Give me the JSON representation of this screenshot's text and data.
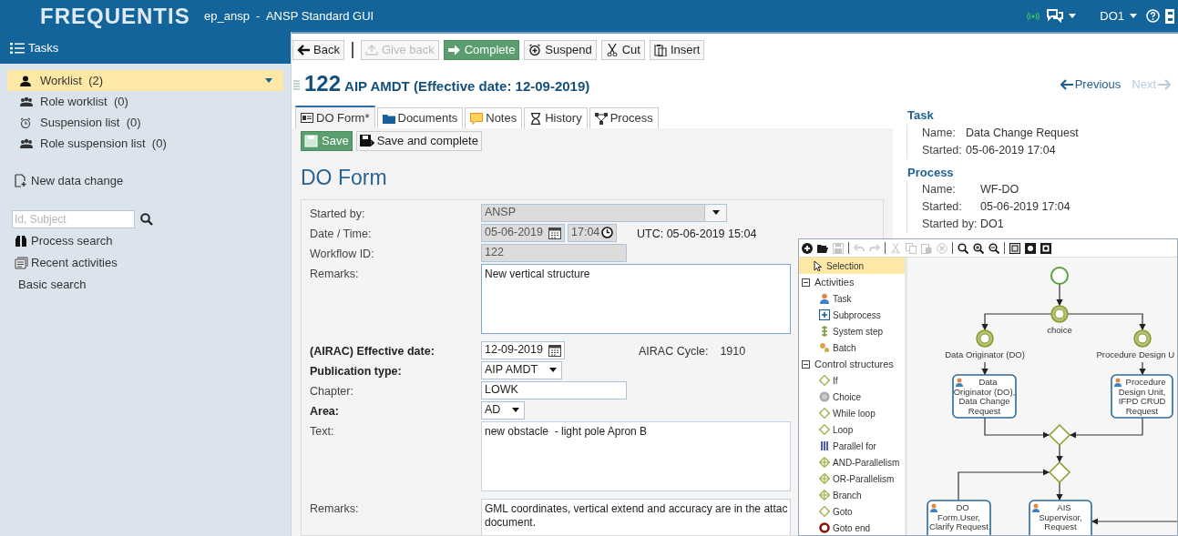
{
  "header": {
    "logo": "FREQUENTIS",
    "title": "ep_ansp  -  ANSP Standard GUI",
    "user": "DO1"
  },
  "sidebar": {
    "title": "Tasks",
    "lists": [
      {
        "kind": "person",
        "label": "Worklist",
        "count": "(2)",
        "selected": true
      },
      {
        "kind": "group",
        "label": "Role worklist",
        "count": "(0)",
        "selected": false
      },
      {
        "kind": "alarm",
        "label": "Suspension list",
        "count": "(0)",
        "selected": false
      },
      {
        "kind": "group",
        "label": "Role suspension list",
        "count": "(0)",
        "selected": false
      }
    ],
    "new_data_change": "New data change",
    "search": {
      "placeholder": "Id, Subject"
    },
    "links": [
      {
        "kind": "binoculars",
        "label": "Process search"
      },
      {
        "kind": "papers",
        "label": "Recent activities"
      },
      {
        "kind": "none",
        "label": "Basic search"
      }
    ]
  },
  "toolbar": [
    {
      "kind": "back",
      "label": "Back",
      "disabled": false
    },
    {
      "kind": "give_back",
      "label": "Give back",
      "disabled": true
    },
    {
      "kind": "complete",
      "label": "Complete",
      "disabled": false
    },
    {
      "kind": "suspend",
      "label": "Suspend",
      "disabled": false
    },
    {
      "kind": "cut",
      "label": "Cut",
      "disabled": false
    },
    {
      "kind": "insert",
      "label": "Insert",
      "disabled": false
    }
  ],
  "task": {
    "number": "122",
    "title": "AIP AMDT (Effective date: 12-09-2019)",
    "previous": {
      "label": "Previous",
      "disabled": false
    },
    "next": {
      "label": "Next",
      "disabled": true
    }
  },
  "tabs": [
    {
      "kind": "form",
      "label": "DO Form*",
      "selected": true
    },
    {
      "kind": "documents",
      "label": "Documents",
      "selected": false
    },
    {
      "kind": "notes",
      "label": "Notes",
      "selected": false
    },
    {
      "kind": "history",
      "label": "History",
      "selected": false
    },
    {
      "kind": "process",
      "label": "Process",
      "selected": false
    }
  ],
  "form_buttons": [
    {
      "kind": "save",
      "label": "Save"
    },
    {
      "kind": "save_complete",
      "label": "Save and complete"
    }
  ],
  "form": {
    "title": "DO Form",
    "fields": [
      {
        "kind": "select",
        "label": "Started by:",
        "bold": false,
        "value": "ANSP",
        "disabled": true
      },
      {
        "kind": "datetime",
        "label": "Date / Time:",
        "bold": false,
        "date": "05-06-2019",
        "time": "17:04",
        "disabled": true,
        "info": "UTC: 05-06-2019 15:04"
      },
      {
        "kind": "text",
        "label": "Workflow ID:",
        "bold": false,
        "value": "122",
        "disabled": true
      },
      {
        "kind": "textarea",
        "label": "Remarks:",
        "bold": false,
        "value": "New vertical structure",
        "focused": true
      },
      {
        "kind": "date",
        "label": "(AIRAC) Effective date:",
        "bold": true,
        "date": "12-09-2019",
        "info_label": "AIRAC Cycle:",
        "info_value": "1910"
      },
      {
        "kind": "select",
        "label": "Publication type:",
        "bold": true,
        "value": "AIP AMDT",
        "disabled": false
      },
      {
        "kind": "spacer"
      },
      {
        "kind": "text",
        "label": "Chapter:",
        "bold": false,
        "value": "LOWK",
        "disabled": false
      },
      {
        "kind": "select",
        "label": "Area:",
        "bold": true,
        "value": "AD",
        "disabled": false
      },
      {
        "kind": "textarea",
        "label": "Text:",
        "bold": false,
        "value": "new obstacle  - light pole Apron B",
        "focused": false
      },
      {
        "kind": "textarea",
        "label": "Remarks:",
        "bold": false,
        "value": "GML coordinates, vertical extend and accuracy are in the attac\ndocument.",
        "focused": false
      }
    ]
  },
  "info": [
    {
      "title": "Task",
      "rows": [
        {
          "label": "Name:",
          "value": "Data Change Request"
        },
        {
          "label": "Started:",
          "value": "05-06-2019 17:04"
        }
      ]
    },
    {
      "title": "Process",
      "rows": [
        {
          "label": "Name:",
          "value": "WF-DO"
        },
        {
          "label": "Started:",
          "value": "05-06-2019 17:04"
        },
        {
          "label": "Started by:",
          "value": "DO1"
        }
      ]
    }
  ],
  "editor": {
    "toolbar": [
      {
        "kind": "add",
        "disabled": false
      },
      {
        "kind": "open",
        "disabled": false
      },
      {
        "kind": "save",
        "disabled": true
      },
      {
        "kind": "sep"
      },
      {
        "kind": "undo",
        "disabled": true
      },
      {
        "kind": "redo",
        "disabled": true
      },
      {
        "kind": "sep"
      },
      {
        "kind": "cut",
        "disabled": true
      },
      {
        "kind": "copy",
        "disabled": true
      },
      {
        "kind": "paste",
        "disabled": true
      },
      {
        "kind": "delete",
        "disabled": true
      },
      {
        "kind": "sep"
      },
      {
        "kind": "zoom",
        "disabled": false
      },
      {
        "kind": "zoom_in",
        "disabled": false
      },
      {
        "kind": "zoom_out",
        "disabled": false
      },
      {
        "kind": "sep"
      },
      {
        "kind": "fit",
        "disabled": false
      },
      {
        "kind": "view",
        "disabled": false
      },
      {
        "kind": "view2",
        "disabled": false
      }
    ],
    "palette": [
      {
        "kind": "selection",
        "label": "Selection",
        "selected": true
      },
      {
        "kind": "group",
        "label": "Activities",
        "expanded": true,
        "children": [
          {
            "kind": "task",
            "label": "Task"
          },
          {
            "kind": "subprocess",
            "label": "Subprocess"
          },
          {
            "kind": "system",
            "label": "System step"
          },
          {
            "kind": "batch",
            "label": "Batch"
          }
        ]
      },
      {
        "kind": "group",
        "label": "Control structures",
        "expanded": true,
        "children": [
          {
            "kind": "if",
            "label": "If"
          },
          {
            "kind": "choice",
            "label": "Choice"
          },
          {
            "kind": "while",
            "label": "While loop"
          },
          {
            "kind": "loop",
            "label": "Loop"
          },
          {
            "kind": "parallel",
            "label": "Parallel for"
          },
          {
            "kind": "and",
            "label": "AND-Parallelism"
          },
          {
            "kind": "or",
            "label": "OR-Parallelism"
          },
          {
            "kind": "branch",
            "label": "Branch"
          },
          {
            "kind": "goto",
            "label": "Goto"
          },
          {
            "kind": "goto_end",
            "label": "Goto end"
          }
        ]
      }
    ],
    "nodes": [
      {
        "kind": "start"
      },
      {
        "kind": "choice",
        "label": "choice"
      },
      {
        "kind": "role",
        "label": "Data Originator (DO)"
      },
      {
        "kind": "role",
        "label": "Procedure Design U"
      },
      {
        "kind": "task",
        "lines": [
          "Data",
          "Originator (DO),",
          "Data Change",
          "Request"
        ]
      },
      {
        "kind": "task",
        "lines": [
          "Procedure",
          "Design Unit,",
          "IFPD CRUD",
          "Request"
        ]
      },
      {
        "kind": "gateway"
      },
      {
        "kind": "gateway"
      },
      {
        "kind": "task",
        "lines": [
          "DO",
          "Form.User,",
          "Clarify Request"
        ]
      },
      {
        "kind": "task",
        "lines": [
          "AIS",
          "Supervisor,",
          "Request"
        ]
      }
    ]
  }
}
